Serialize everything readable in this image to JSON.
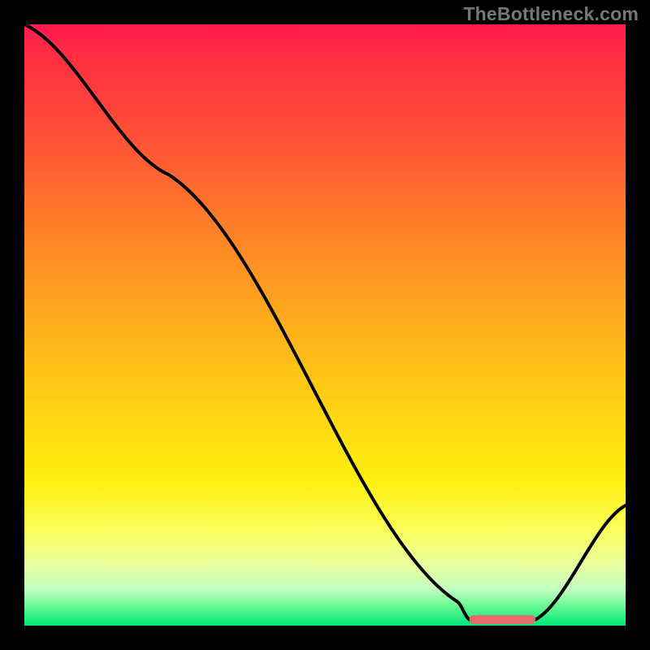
{
  "watermark": "TheBottleneck.com",
  "chart_data": {
    "type": "line",
    "title": "",
    "xlabel": "",
    "ylabel": "",
    "xlim": [
      0,
      100
    ],
    "ylim": [
      0,
      100
    ],
    "grid": false,
    "curve_percent": [
      {
        "x": 0,
        "y": 100
      },
      {
        "x": 24,
        "y": 75
      },
      {
        "x": 72,
        "y": 4
      },
      {
        "x": 74,
        "y": 1
      },
      {
        "x": 85,
        "y": 1
      },
      {
        "x": 100,
        "y": 20
      }
    ],
    "marker_band_percent": {
      "x_start": 74,
      "x_end": 85,
      "y": 1
    },
    "marker_color": "#e86a6a",
    "gradient_stops": [
      {
        "pos": 0.0,
        "color": "#ff1a50"
      },
      {
        "pos": 0.06,
        "color": "#ff3040"
      },
      {
        "pos": 0.2,
        "color": "#ff5436"
      },
      {
        "pos": 0.34,
        "color": "#ff8028"
      },
      {
        "pos": 0.48,
        "color": "#ffa81e"
      },
      {
        "pos": 0.62,
        "color": "#ffce14"
      },
      {
        "pos": 0.76,
        "color": "#fff010"
      },
      {
        "pos": 0.84,
        "color": "#fbff5a"
      },
      {
        "pos": 0.9,
        "color": "#e8ffa0"
      },
      {
        "pos": 0.94,
        "color": "#c0ffc0"
      },
      {
        "pos": 0.97,
        "color": "#60f890"
      },
      {
        "pos": 1.0,
        "color": "#00e878"
      }
    ]
  }
}
